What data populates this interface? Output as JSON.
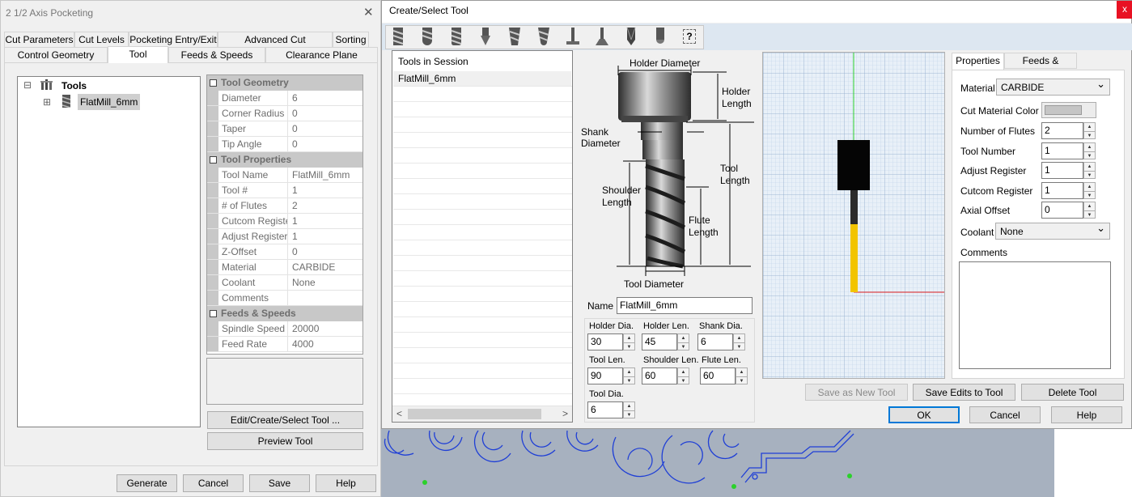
{
  "left_dialog": {
    "title": "2 1/2 Axis Pocketing",
    "close_glyph": "✕",
    "tabs_row1": [
      "Cut Parameters",
      "Cut Levels",
      "Pocketing Entry/Exit",
      "Advanced Cut Parameters",
      "Sorting"
    ],
    "tabs_row2": [
      "Control Geometry",
      "Tool",
      "Feeds & Speeds",
      "Clearance Plane"
    ],
    "active_tab": "Tool",
    "tree": {
      "root_label": "Tools",
      "child_label": "FlatMill_6mm",
      "expand_glyph": "⊞",
      "collapse_glyph": "⊟"
    },
    "property_grid": {
      "categories": [
        {
          "name": "Tool Geometry",
          "rows": [
            {
              "key": "Diameter",
              "value": "6"
            },
            {
              "key": "Corner Radius",
              "value": "0"
            },
            {
              "key": "Taper",
              "value": "0"
            },
            {
              "key": "Tip Angle",
              "value": "0"
            }
          ]
        },
        {
          "name": "Tool Properties",
          "rows": [
            {
              "key": "Tool Name",
              "value": "FlatMill_6mm"
            },
            {
              "key": "Tool #",
              "value": "1"
            },
            {
              "key": "# of Flutes",
              "value": "2"
            },
            {
              "key": "Cutcom Registe",
              "value": "1"
            },
            {
              "key": "Adjust Register",
              "value": "1"
            },
            {
              "key": "Z-Offset",
              "value": "0"
            },
            {
              "key": "Material",
              "value": " CARBIDE"
            },
            {
              "key": "Coolant",
              "value": "None"
            },
            {
              "key": "Comments",
              "value": ""
            }
          ]
        },
        {
          "name": "Feeds & Speeds",
          "rows": [
            {
              "key": "Spindle Speed",
              "value": "20000"
            },
            {
              "key": "Feed Rate",
              "value": "4000"
            }
          ]
        }
      ]
    },
    "edit_button": "Edit/Create/Select Tool ...",
    "preview_button": "Preview Tool",
    "footer_buttons": [
      "Generate",
      "Cancel",
      "Save",
      "Help"
    ]
  },
  "right_dialog": {
    "title": "Create/Select Tool",
    "close_glyph": "x",
    "toolbar_icons": [
      "flat-mill-icon",
      "ball-mill-icon",
      "bull-mill-icon",
      "v-bit-icon",
      "taper-flat-icon",
      "taper-ball-icon",
      "tslot-icon",
      "dovetail-icon",
      "drill-icon",
      "engrave-icon",
      "help-icon"
    ],
    "toolbar_help_glyph": "?",
    "session": {
      "header": "Tools in Session",
      "items": [
        "FlatMill_6mm"
      ],
      "scroll_left": "<",
      "scroll_right": ">"
    },
    "diagram_labels": {
      "holder_diameter": "Holder Diameter",
      "holder_length_1": "Holder",
      "holder_length_2": "Length",
      "shank_diameter_1": "Shank",
      "shank_diameter_2": "Diameter",
      "tool_length_1": "Tool",
      "tool_length_2": "Length",
      "shoulder_length_1": "Shoulder",
      "shoulder_length_2": "Length",
      "flute_length_1": "Flute",
      "flute_length_2": "Length",
      "tool_diameter": "Tool Diameter"
    },
    "name_label": "Name",
    "name_value": "FlatMill_6mm",
    "dimensions": [
      {
        "label": "Holder Dia.",
        "value": "30"
      },
      {
        "label": "Holder Len.",
        "value": "45"
      },
      {
        "label": "Shank Dia.",
        "value": "6"
      },
      {
        "label": "Tool Len.",
        "value": "90"
      },
      {
        "label": "Shoulder Len.",
        "value": "60"
      },
      {
        "label": "Flute Len.",
        "value": "60"
      },
      {
        "label": "Tool Dia.",
        "value": "6"
      }
    ],
    "spin_up": "▲",
    "spin_down": "▼",
    "prop_tabs": [
      "Properties",
      "Feeds & Speeds"
    ],
    "active_prop_tab": "Properties",
    "properties": {
      "material_label": "Material",
      "material_value": "CARBIDE",
      "cut_color_label": "Cut Material Color",
      "flutes_label": "Number of Flutes",
      "flutes_value": "2",
      "tool_number_label": "Tool Number",
      "tool_number_value": "1",
      "adjust_label": "Adjust Register",
      "adjust_value": "1",
      "cutcom_label": "Cutcom Register",
      "cutcom_value": "1",
      "axial_label": "Axial Offset",
      "axial_value": "0",
      "coolant_label": "Coolant",
      "coolant_value": "None",
      "comments_label": "Comments",
      "dropdown_glyph": "⌄"
    },
    "action_buttons": [
      "Save as New Tool",
      "Save Edits to Tool",
      "Delete Tool"
    ],
    "footer_buttons": [
      "OK",
      "Cancel",
      "Help"
    ]
  },
  "colors": {
    "dialog_bg": "#f0f0f0",
    "cad_bg": "#a7b1bf",
    "toolpath_blue": "#1f3fd6",
    "preview_grid": "#dbe8f5",
    "tool_yellow": "#f2c400",
    "close_red": "#e81123"
  }
}
